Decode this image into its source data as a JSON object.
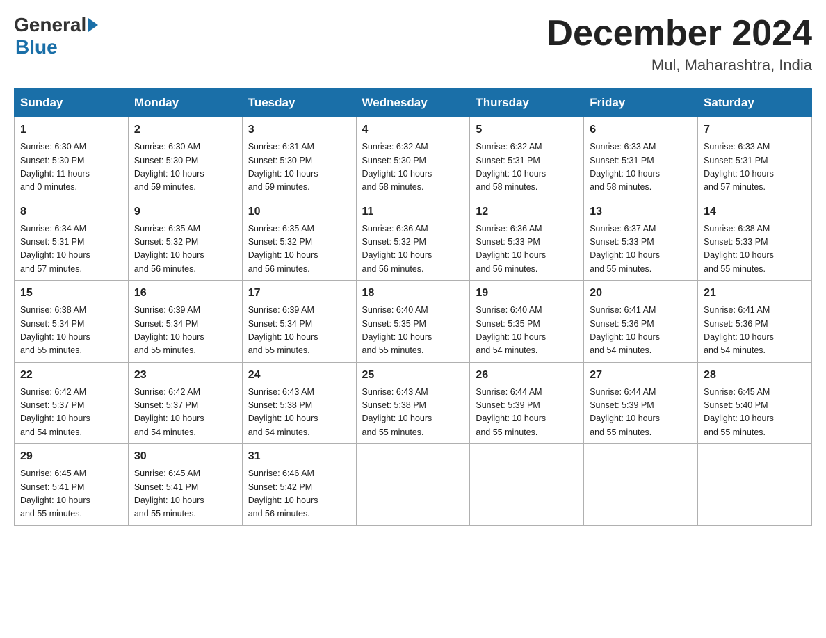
{
  "header": {
    "logo_general": "General",
    "logo_blue": "Blue",
    "month_title": "December 2024",
    "location": "Mul, Maharashtra, India"
  },
  "weekdays": [
    "Sunday",
    "Monday",
    "Tuesday",
    "Wednesday",
    "Thursday",
    "Friday",
    "Saturday"
  ],
  "weeks": [
    [
      {
        "day": "1",
        "sunrise": "6:30 AM",
        "sunset": "5:30 PM",
        "daylight": "11 hours and 0 minutes."
      },
      {
        "day": "2",
        "sunrise": "6:30 AM",
        "sunset": "5:30 PM",
        "daylight": "10 hours and 59 minutes."
      },
      {
        "day": "3",
        "sunrise": "6:31 AM",
        "sunset": "5:30 PM",
        "daylight": "10 hours and 59 minutes."
      },
      {
        "day": "4",
        "sunrise": "6:32 AM",
        "sunset": "5:30 PM",
        "daylight": "10 hours and 58 minutes."
      },
      {
        "day": "5",
        "sunrise": "6:32 AM",
        "sunset": "5:31 PM",
        "daylight": "10 hours and 58 minutes."
      },
      {
        "day": "6",
        "sunrise": "6:33 AM",
        "sunset": "5:31 PM",
        "daylight": "10 hours and 58 minutes."
      },
      {
        "day": "7",
        "sunrise": "6:33 AM",
        "sunset": "5:31 PM",
        "daylight": "10 hours and 57 minutes."
      }
    ],
    [
      {
        "day": "8",
        "sunrise": "6:34 AM",
        "sunset": "5:31 PM",
        "daylight": "10 hours and 57 minutes."
      },
      {
        "day": "9",
        "sunrise": "6:35 AM",
        "sunset": "5:32 PM",
        "daylight": "10 hours and 56 minutes."
      },
      {
        "day": "10",
        "sunrise": "6:35 AM",
        "sunset": "5:32 PM",
        "daylight": "10 hours and 56 minutes."
      },
      {
        "day": "11",
        "sunrise": "6:36 AM",
        "sunset": "5:32 PM",
        "daylight": "10 hours and 56 minutes."
      },
      {
        "day": "12",
        "sunrise": "6:36 AM",
        "sunset": "5:33 PM",
        "daylight": "10 hours and 56 minutes."
      },
      {
        "day": "13",
        "sunrise": "6:37 AM",
        "sunset": "5:33 PM",
        "daylight": "10 hours and 55 minutes."
      },
      {
        "day": "14",
        "sunrise": "6:38 AM",
        "sunset": "5:33 PM",
        "daylight": "10 hours and 55 minutes."
      }
    ],
    [
      {
        "day": "15",
        "sunrise": "6:38 AM",
        "sunset": "5:34 PM",
        "daylight": "10 hours and 55 minutes."
      },
      {
        "day": "16",
        "sunrise": "6:39 AM",
        "sunset": "5:34 PM",
        "daylight": "10 hours and 55 minutes."
      },
      {
        "day": "17",
        "sunrise": "6:39 AM",
        "sunset": "5:34 PM",
        "daylight": "10 hours and 55 minutes."
      },
      {
        "day": "18",
        "sunrise": "6:40 AM",
        "sunset": "5:35 PM",
        "daylight": "10 hours and 55 minutes."
      },
      {
        "day": "19",
        "sunrise": "6:40 AM",
        "sunset": "5:35 PM",
        "daylight": "10 hours and 54 minutes."
      },
      {
        "day": "20",
        "sunrise": "6:41 AM",
        "sunset": "5:36 PM",
        "daylight": "10 hours and 54 minutes."
      },
      {
        "day": "21",
        "sunrise": "6:41 AM",
        "sunset": "5:36 PM",
        "daylight": "10 hours and 54 minutes."
      }
    ],
    [
      {
        "day": "22",
        "sunrise": "6:42 AM",
        "sunset": "5:37 PM",
        "daylight": "10 hours and 54 minutes."
      },
      {
        "day": "23",
        "sunrise": "6:42 AM",
        "sunset": "5:37 PM",
        "daylight": "10 hours and 54 minutes."
      },
      {
        "day": "24",
        "sunrise": "6:43 AM",
        "sunset": "5:38 PM",
        "daylight": "10 hours and 54 minutes."
      },
      {
        "day": "25",
        "sunrise": "6:43 AM",
        "sunset": "5:38 PM",
        "daylight": "10 hours and 55 minutes."
      },
      {
        "day": "26",
        "sunrise": "6:44 AM",
        "sunset": "5:39 PM",
        "daylight": "10 hours and 55 minutes."
      },
      {
        "day": "27",
        "sunrise": "6:44 AM",
        "sunset": "5:39 PM",
        "daylight": "10 hours and 55 minutes."
      },
      {
        "day": "28",
        "sunrise": "6:45 AM",
        "sunset": "5:40 PM",
        "daylight": "10 hours and 55 minutes."
      }
    ],
    [
      {
        "day": "29",
        "sunrise": "6:45 AM",
        "sunset": "5:41 PM",
        "daylight": "10 hours and 55 minutes."
      },
      {
        "day": "30",
        "sunrise": "6:45 AM",
        "sunset": "5:41 PM",
        "daylight": "10 hours and 55 minutes."
      },
      {
        "day": "31",
        "sunrise": "6:46 AM",
        "sunset": "5:42 PM",
        "daylight": "10 hours and 56 minutes."
      },
      null,
      null,
      null,
      null
    ]
  ],
  "labels": {
    "sunrise": "Sunrise:",
    "sunset": "Sunset:",
    "daylight": "Daylight:"
  }
}
